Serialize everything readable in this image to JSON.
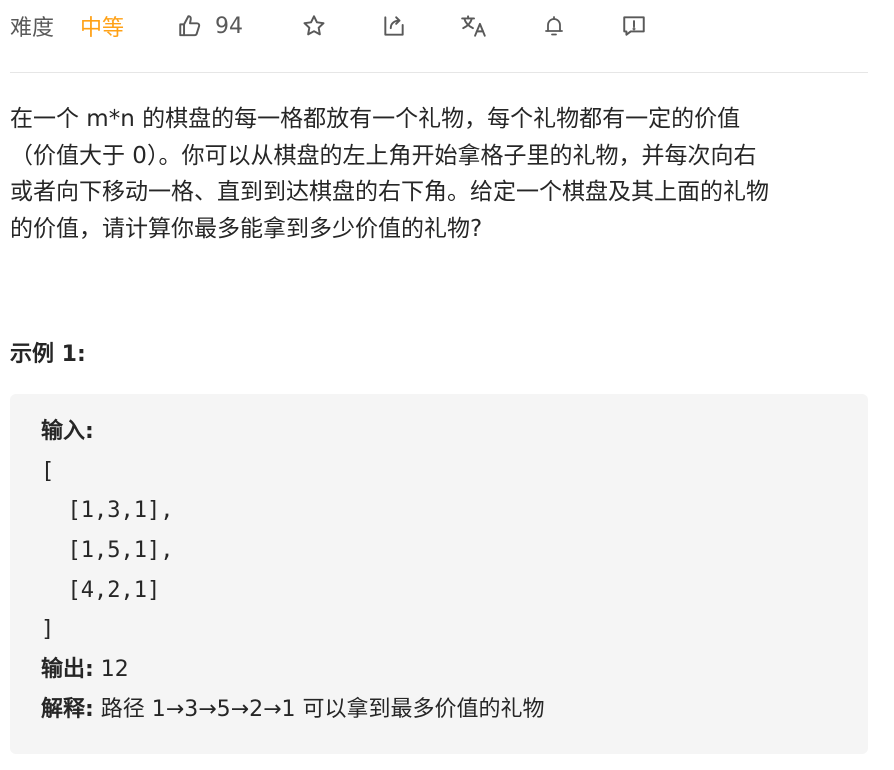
{
  "toolbar": {
    "difficulty_label": "难度",
    "difficulty_value": "中等",
    "like_count": "94",
    "icons": [
      "thumbs-up-icon",
      "star-icon",
      "share-icon",
      "translate-icon",
      "bell-icon",
      "feedback-icon"
    ]
  },
  "colors": {
    "difficulty_medium": "#ffa116",
    "muted": "#595959",
    "text": "#262626",
    "code_bg": "#f5f5f5",
    "divider": "#e6e6e6"
  },
  "problem": {
    "description_lines": [
      "在一个 m*n 的棋盘的每一格都放有一个礼物，每个礼物都有一定的价值",
      "（价值大于 0）。你可以从棋盘的左上角开始拿格子里的礼物，并每次向右",
      "或者向下移动一格、直到到达棋盘的右下角。给定一个棋盘及其上面的礼物",
      "的价值，请计算你最多能拿到多少价值的礼物?"
    ],
    "example_title": "示例 1:",
    "example": {
      "input_label": "输入:",
      "input_lines": [
        "[",
        "  [1,3,1],",
        "  [1,5,1],",
        "  [4,2,1]",
        "]"
      ],
      "output_label": "输出:",
      "output_value": " 12",
      "explanation_label": "解释:",
      "explanation_value": " 路径 1→3→5→2→1 可以拿到最多价值的礼物"
    }
  }
}
